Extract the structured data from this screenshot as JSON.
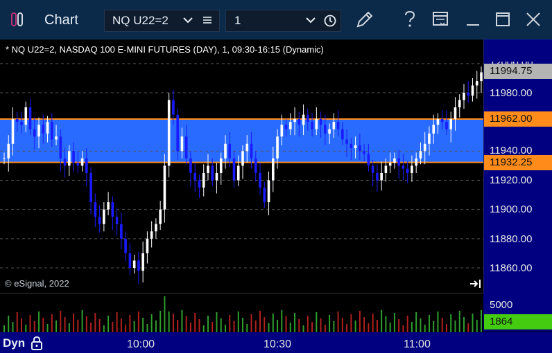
{
  "window": {
    "title": "Chart",
    "symbol": "NQ U22=2",
    "interval": "1",
    "icons": [
      "app-logo-icon",
      "chevron-down-icon",
      "menu-icon",
      "chevron-down-icon",
      "clock-icon",
      "pencil-icon",
      "help-icon",
      "window-layout-icon",
      "minimize-icon",
      "maximize-icon",
      "close-icon"
    ]
  },
  "chart": {
    "description": "* NQ U22=2, NASDAQ 100 E-MINI FUTURES (DAY), 1, 09:30-16:15 (Dynamic)",
    "copyright": "© eSignal, 2022",
    "price_axis": [
      "12000.00",
      "11980.00",
      "11940.00",
      "11920.00",
      "11900.00",
      "11880.00",
      "11860.00"
    ],
    "tags": {
      "last_price": "11994.75",
      "upper_line": "11962.00",
      "lower_line": "11932.25",
      "volume": "1864"
    },
    "volume_axis": "5000",
    "time_axis": [
      "10:00",
      "10:30",
      "11:00"
    ],
    "mode_label": "Dyn",
    "colors": {
      "up": "#ffffff",
      "down": "#1a1aff",
      "band": "#2a6bff",
      "band_line": "#ff8c1a",
      "tag_last": "#b4b4b4",
      "tag_level": "#ff8c1a",
      "tag_volume": "#44cc11",
      "axis_bg": "#000080"
    }
  },
  "chart_data": {
    "type": "candlestick",
    "title": "* NQ U22=2, NASDAQ 100 E-MINI FUTURES (DAY), 1, 09:30-16:15 (Dynamic)",
    "ylim": [
      11850,
      12005
    ],
    "y_ticks": [
      11860,
      11880,
      11900,
      11920,
      11940,
      11980,
      12000
    ],
    "x_labels": [
      "10:00",
      "10:30",
      "11:00"
    ],
    "horizontal_band": {
      "low": 11932.25,
      "high": 11962.0
    },
    "last_price": 11994.75,
    "volume_last": 1864,
    "volume_axis_max_label": 5000,
    "close_series": [
      11935,
      11945,
      11962,
      11960,
      11958,
      11970,
      11955,
      11950,
      11958,
      11952,
      11960,
      11948,
      11950,
      11935,
      11930,
      11940,
      11932,
      11930,
      11935,
      11925,
      11905,
      11895,
      11890,
      11900,
      11905,
      11895,
      11890,
      11880,
      11870,
      11860,
      11865,
      11858,
      11870,
      11880,
      11885,
      11890,
      11900,
      11930,
      11975,
      11965,
      11940,
      11950,
      11935,
      11925,
      11920,
      11915,
      11925,
      11930,
      11920,
      11925,
      11935,
      11945,
      11935,
      11920,
      11930,
      11940,
      11945,
      11935,
      11925,
      11915,
      11905,
      11920,
      11935,
      11950,
      11958,
      11955,
      11960,
      11962,
      11958,
      11965,
      11960,
      11955,
      11962,
      11958,
      11952,
      11955,
      11960,
      11955,
      11948,
      11945,
      11942,
      11944,
      11940,
      11938,
      11930,
      11925,
      11920,
      11925,
      11930,
      11932,
      11935,
      11930,
      11928,
      11925,
      11930,
      11935,
      11940,
      11945,
      11952,
      11958,
      11962,
      11960,
      11955,
      11962,
      11970,
      11975,
      11980,
      11978,
      11985,
      11988,
      11994
    ]
  }
}
